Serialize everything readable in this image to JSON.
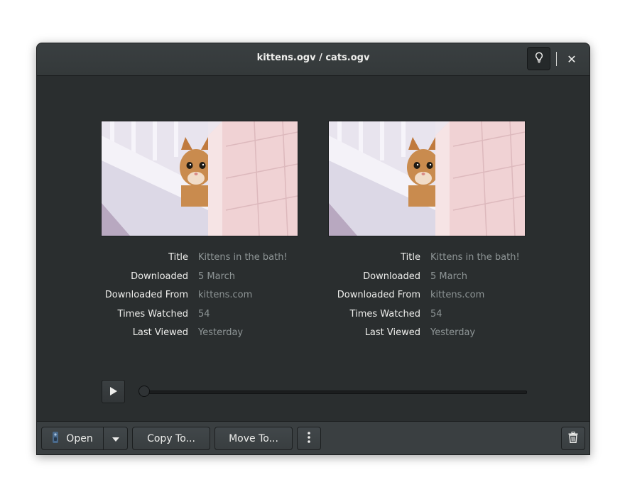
{
  "window": {
    "title": "kittens.ogv / cats.ogv",
    "header_icons": [
      "lightbulb-icon",
      "close-icon"
    ],
    "close_glyph": "✕"
  },
  "files": [
    {
      "properties": [
        {
          "label": "Title",
          "value": "Kittens in the bath!"
        },
        {
          "label": "Downloaded",
          "value": "5 March"
        },
        {
          "label": "Downloaded From",
          "value": "kittens.com"
        },
        {
          "label": "Times Watched",
          "value": "54"
        },
        {
          "label": "Last Viewed",
          "value": "Yesterday"
        }
      ]
    },
    {
      "properties": [
        {
          "label": "Title",
          "value": "Kittens in the bath!"
        },
        {
          "label": "Downloaded",
          "value": "5 March"
        },
        {
          "label": "Downloaded From",
          "value": "kittens.com"
        },
        {
          "label": "Times Watched",
          "value": "54"
        },
        {
          "label": "Last Viewed",
          "value": "Yesterday"
        }
      ]
    }
  ],
  "player": {
    "progress": 0,
    "icons": [
      "play-icon"
    ]
  },
  "toolbar": {
    "open_label": "Open",
    "copy_label": "Copy To...",
    "move_label": "Move To...",
    "icons": [
      "app-icon",
      "chevron-down-icon",
      "more-vertical-icon",
      "trash-icon"
    ]
  },
  "colors": {
    "window_bg": "#2a2e2f",
    "header_bg": "#383d3f",
    "label_text": "#eeeeec",
    "value_text": "#8e9596"
  }
}
